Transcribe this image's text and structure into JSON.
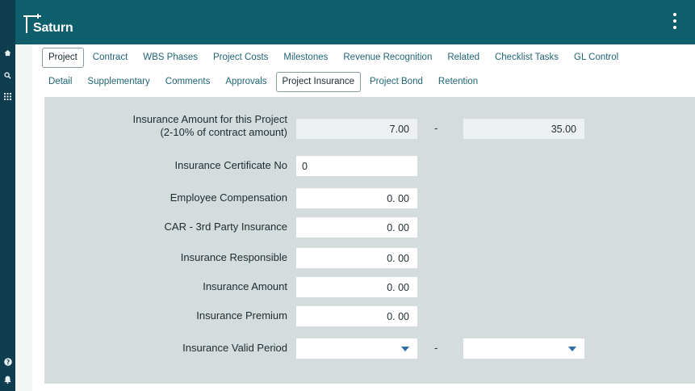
{
  "app": {
    "name": "Saturn"
  },
  "tabs_row1": [
    {
      "label": "Project",
      "active": true
    },
    {
      "label": "Contract",
      "active": false
    },
    {
      "label": "WBS Phases",
      "active": false
    },
    {
      "label": "Project Costs",
      "active": false
    },
    {
      "label": "Milestones",
      "active": false
    },
    {
      "label": "Revenue Recognition",
      "active": false
    },
    {
      "label": "Related",
      "active": false
    },
    {
      "label": "Checklist Tasks",
      "active": false
    },
    {
      "label": "GL Control",
      "active": false
    }
  ],
  "tabs_row2": [
    {
      "label": "Detail",
      "active": false
    },
    {
      "label": "Supplementary",
      "active": false
    },
    {
      "label": "Comments",
      "active": false
    },
    {
      "label": "Approvals",
      "active": false
    },
    {
      "label": "Project Insurance",
      "active": true
    },
    {
      "label": "Project Bond",
      "active": false
    },
    {
      "label": "Retention",
      "active": false
    }
  ],
  "form": {
    "insurance_amount_range": {
      "label_line1": "Insurance Amount for this Project",
      "label_line2": "(2-10% of contract amount)",
      "from": "7.00",
      "to": "35.00",
      "separator": "-"
    },
    "certificate_no": {
      "label": "Insurance Certificate No",
      "value": "0"
    },
    "employee_compensation": {
      "label": "Employee Compensation",
      "value": "0. 00"
    },
    "car_3rd_party": {
      "label": "CAR - 3rd Party Insurance",
      "value": "0. 00"
    },
    "insurance_responsible": {
      "label": "Insurance Responsible",
      "value": "0. 00"
    },
    "insurance_amount": {
      "label": "Insurance Amount",
      "value": "0. 00"
    },
    "insurance_premium": {
      "label": "Insurance Premium",
      "value": "0. 00"
    },
    "valid_period": {
      "label": "Insurance Valid Period",
      "from": "",
      "to": "",
      "separator": "-"
    }
  },
  "icons": {
    "rail_top": [
      "home-icon",
      "search-icon",
      "grid-icon"
    ],
    "rail_bottom": [
      "help-icon",
      "bell-icon"
    ]
  }
}
